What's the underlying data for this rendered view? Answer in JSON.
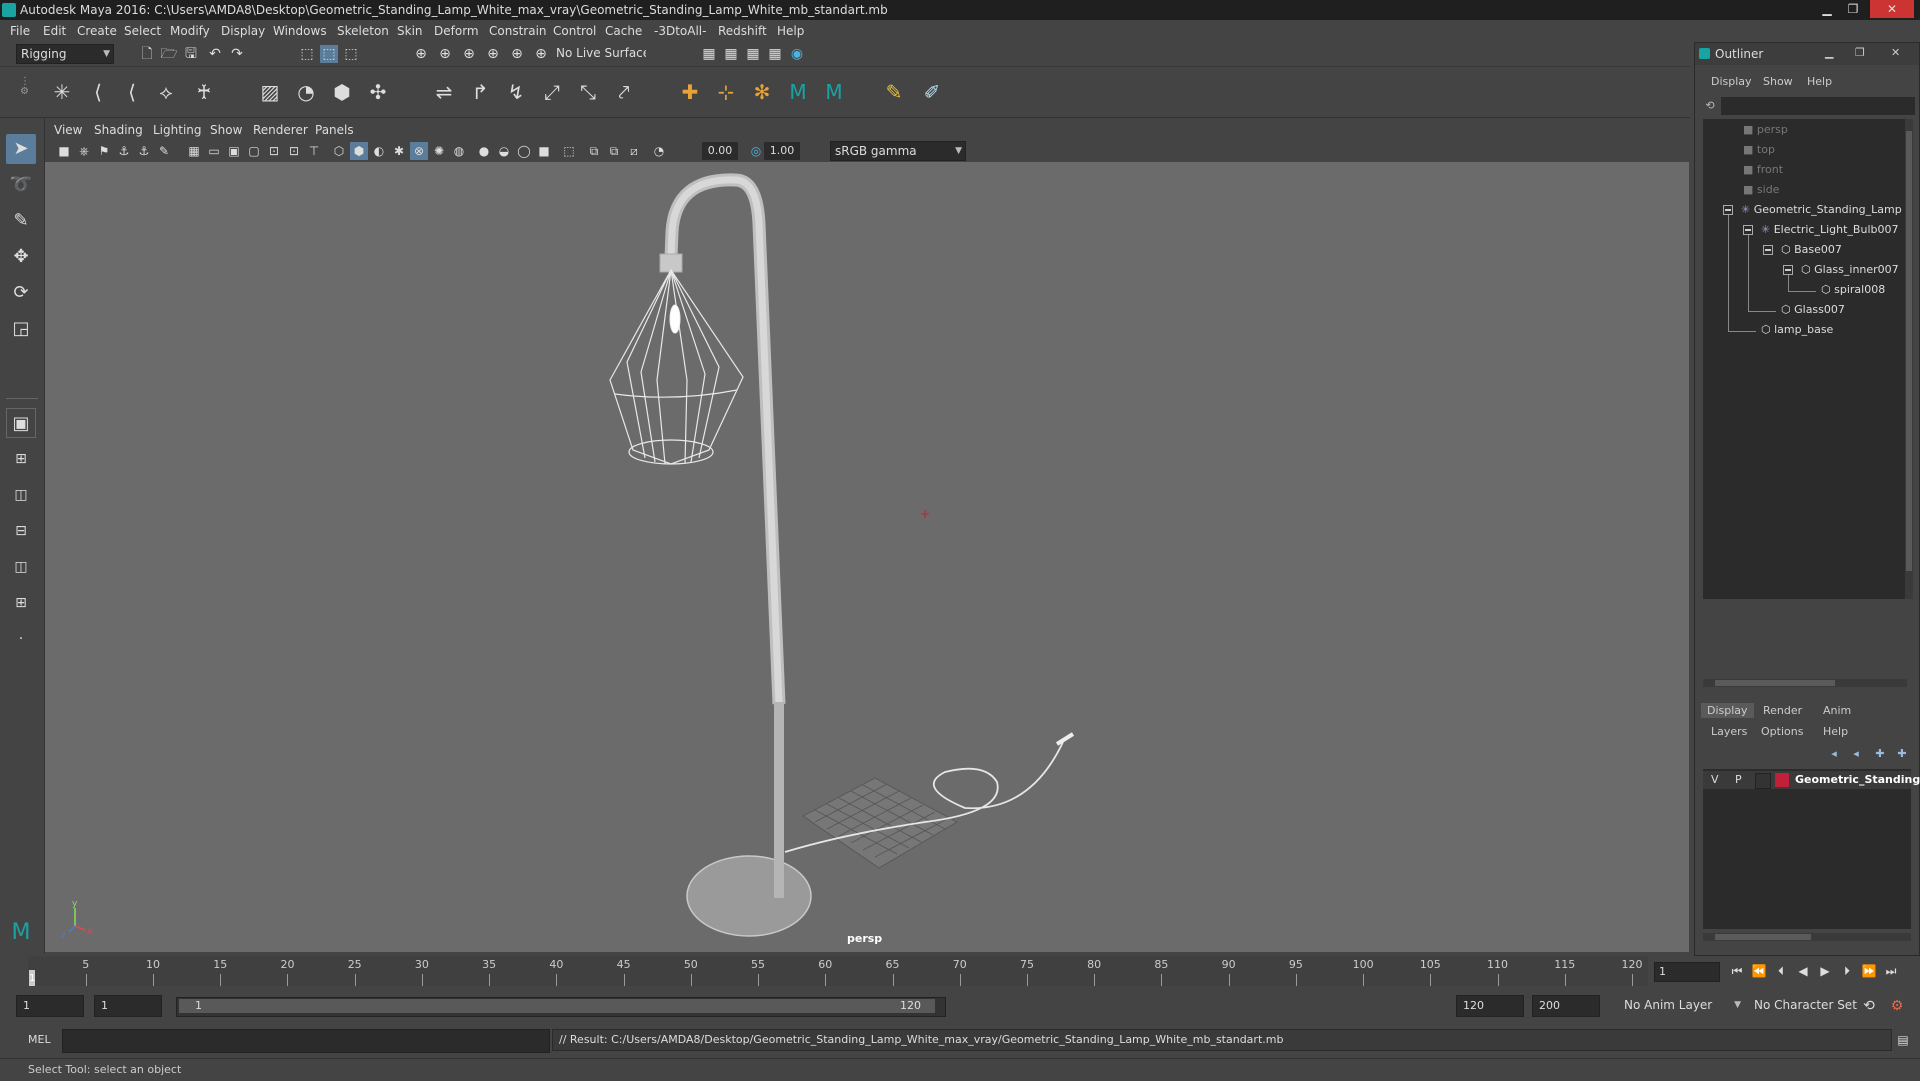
{
  "window": {
    "title": "Autodesk Maya 2016: C:\\Users\\AMDA8\\Desktop\\Geometric_Standing_Lamp_White_max_vray\\Geometric_Standing_Lamp_White_mb_standart.mb",
    "minimize": "▁",
    "restore": "❐",
    "close": "✕"
  },
  "menubar": [
    "File",
    "Edit",
    "Create",
    "Select",
    "Modify",
    "Display",
    "Windows",
    "Skeleton",
    "Skin",
    "Deform",
    "Constrain",
    "Control",
    "Cache",
    "-3DtoAll-",
    "Redshift",
    "Help"
  ],
  "statusline": {
    "menuset": "Rigging",
    "live_surface": "No Live Surface"
  },
  "viewport": {
    "menus": [
      "View",
      "Shading",
      "Lighting",
      "Show",
      "Renderer",
      "Panels"
    ],
    "exposure": "0.00",
    "gamma": "1.00",
    "colorspace": "sRGB gamma",
    "camera_label": "persp",
    "axis_x": "x",
    "axis_y": "y",
    "axis_z": "z"
  },
  "timeline": {
    "ticks": [
      1,
      5,
      10,
      15,
      20,
      25,
      30,
      35,
      40,
      45,
      50,
      55,
      60,
      65,
      70,
      75,
      80,
      85,
      90,
      95,
      100,
      105,
      110,
      115,
      120
    ],
    "labels": [
      "5",
      "10",
      "15",
      "20",
      "25",
      "30",
      "35",
      "40",
      "45",
      "50",
      "55",
      "60",
      "65",
      "70",
      "75",
      "80",
      "85",
      "90",
      "95",
      "100",
      "105",
      "110",
      "115",
      "120"
    ],
    "current_frame_label": "1",
    "current_frame": "1"
  },
  "range": {
    "start": "1",
    "playback_start": "1",
    "slider_start": "1",
    "slider_end": "120",
    "playback_end": "120",
    "end": "200",
    "anim_layer": "No Anim Layer",
    "character_set": "No Character Set"
  },
  "command": {
    "lang": "MEL",
    "result": "// Result: C:/Users/AMDA8/Desktop/Geometric_Standing_Lamp_White_max_vray/Geometric_Standing_Lamp_White_mb_standart.mb"
  },
  "helpline": "Select Tool: select an object",
  "outliner": {
    "title": "Outliner",
    "menus": [
      "Display",
      "Show",
      "Help"
    ],
    "items": [
      {
        "label": "persp",
        "dim": true
      },
      {
        "label": "top",
        "dim": true
      },
      {
        "label": "front",
        "dim": true
      },
      {
        "label": "side",
        "dim": true
      },
      {
        "label": "Geometric_Standing_Lamp",
        "dim": false
      },
      {
        "label": "Electric_Light_Bulb007",
        "dim": false
      },
      {
        "label": "Base007",
        "dim": false
      },
      {
        "label": "Glass_inner007",
        "dim": false
      },
      {
        "label": "spiral008",
        "dim": false
      },
      {
        "label": "Glass007",
        "dim": false
      },
      {
        "label": "lamp_base",
        "dim": false
      }
    ]
  },
  "layers": {
    "tabs": [
      "Display",
      "Render",
      "Anim"
    ],
    "menus": [
      "Layers",
      "Options",
      "Help"
    ],
    "layer": {
      "v": "V",
      "p": "P",
      "name": "Geometric_Standing_L",
      "color": "#c0203a"
    }
  },
  "colors": {
    "accent": "#5b7d9c",
    "viewport_bg": "#6b6b6b",
    "layer_red": "#c0203a",
    "maya_teal": "#1aa3a3"
  }
}
